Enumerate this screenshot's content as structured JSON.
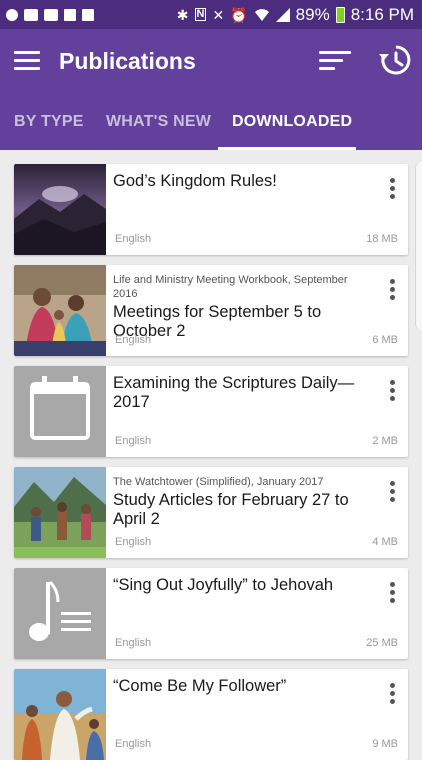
{
  "status_bar": {
    "battery_percent": "89%",
    "time": "8:16 PM",
    "icons": [
      "directv-icon",
      "message-icon",
      "gmail-icon",
      "image-icon",
      "image-icon",
      "bluetooth-icon",
      "nfc-icon",
      "mute-icon",
      "alarm-icon",
      "wifi-icon",
      "signal-icon",
      "battery-icon"
    ]
  },
  "app_bar": {
    "title": "Publications"
  },
  "tabs": [
    {
      "label": "BY TYPE",
      "active": false
    },
    {
      "label": "WHAT'S NEW",
      "active": false
    },
    {
      "label": "DOWNLOADED",
      "active": true
    }
  ],
  "publications": [
    {
      "subtitle": "",
      "title": "God’s Kingdom Rules!",
      "language": "English",
      "size": "18 MB",
      "thumb": "mountain-sunrise"
    },
    {
      "subtitle": "Life and Ministry Meeting Workbook, September 2016",
      "title": "Meetings for September 5 to October 2",
      "language": "English",
      "size": "6 MB",
      "thumb": "family-photo"
    },
    {
      "subtitle": "",
      "title": "Examining the Scriptures Daily—2017",
      "language": "English",
      "size": "2 MB",
      "thumb": "calendar-icon"
    },
    {
      "subtitle": "The Watchtower (Simplified), January 2017",
      "title": "Study Articles for February 27 to April 2",
      "language": "English",
      "size": "4 MB",
      "thumb": "hikers-photo"
    },
    {
      "subtitle": "",
      "title": "“Sing Out Joyfully” to Jehovah",
      "language": "English",
      "size": "25 MB",
      "thumb": "music-note-icon"
    },
    {
      "subtitle": "",
      "title": "“Come Be My Follower”",
      "language": "English",
      "size": "9 MB",
      "thumb": "jesus-painting"
    }
  ],
  "colors": {
    "status_bar": "#4b2c7e",
    "app_bar": "#62409b",
    "tab_inactive": "#cbbde0",
    "background": "#ececec"
  }
}
